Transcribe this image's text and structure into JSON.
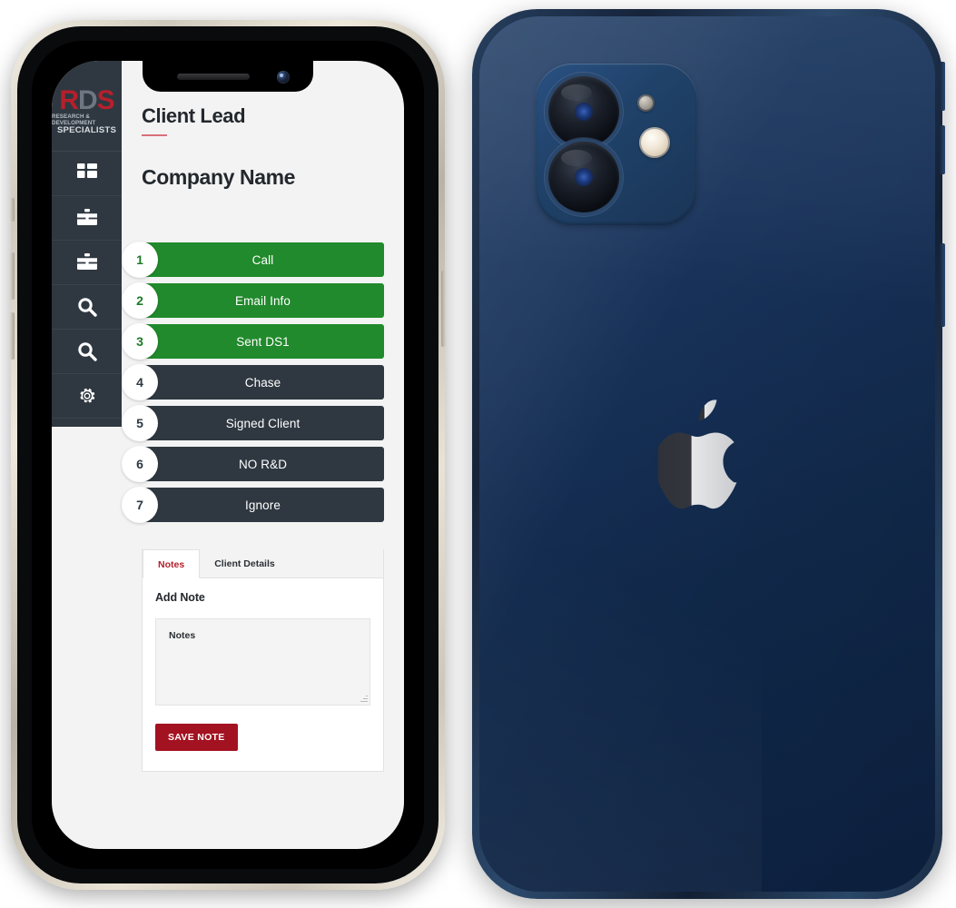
{
  "app": {
    "brand": {
      "logo_main": "RDS",
      "logo_main_letter1": "R",
      "logo_main_letter2": "D",
      "logo_main_letter3": "S",
      "logo_sub_line1": "RESEARCH & DEVELOPMENT",
      "logo_sub_line2": "SPECIALISTS",
      "accent_red": "#b5202c",
      "accent_gray": "#6d7681"
    },
    "sidebar": {
      "background": "#2f3841",
      "items": [
        {
          "name": "dashboard",
          "icon": "grid-icon"
        },
        {
          "name": "briefcase-1",
          "icon": "briefcase-icon"
        },
        {
          "name": "briefcase-2",
          "icon": "briefcase-icon"
        },
        {
          "name": "search-1",
          "icon": "search-icon"
        },
        {
          "name": "search-2",
          "icon": "search-icon"
        },
        {
          "name": "settings",
          "icon": "gear-icon"
        }
      ]
    },
    "header": {
      "page_title": "Client Lead",
      "company_name": "Company Name"
    },
    "steps": [
      {
        "number": "1",
        "label": "Call",
        "state": "green"
      },
      {
        "number": "2",
        "label": "Email Info",
        "state": "green"
      },
      {
        "number": "3",
        "label": "Sent DS1",
        "state": "green"
      },
      {
        "number": "4",
        "label": "Chase",
        "state": "dark"
      },
      {
        "number": "5",
        "label": "Signed Client",
        "state": "dark"
      },
      {
        "number": "6",
        "label": "NO R&D",
        "state": "dark"
      },
      {
        "number": "7",
        "label": "Ignore",
        "state": "dark"
      }
    ],
    "step_colors": {
      "green": "#218a2c",
      "dark": "#2f3841"
    },
    "notes_panel": {
      "tabs": [
        {
          "label": "Notes",
          "active": true
        },
        {
          "label": "Client Details",
          "active": false
        }
      ],
      "add_note_heading": "Add Note",
      "textarea_placeholder": "Notes",
      "textarea_value": "",
      "save_button_label": "SAVE NOTE",
      "save_button_color": "#a31220"
    }
  },
  "devices": {
    "front": {
      "name": "iPhone front view",
      "frame_color": "#d9d3c7",
      "screen_bg": "#f3f3f3",
      "buttons": [
        "silence-switch",
        "volume-up",
        "volume-down",
        "power-button"
      ]
    },
    "back": {
      "name": "iPhone back view",
      "body_color": "#16325a",
      "logo": "apple-logo",
      "camera": {
        "lens_count": "2",
        "has_flash": "true",
        "has_microphone": "true"
      },
      "buttons": [
        "volume-up",
        "volume-down",
        "power-button"
      ]
    }
  }
}
